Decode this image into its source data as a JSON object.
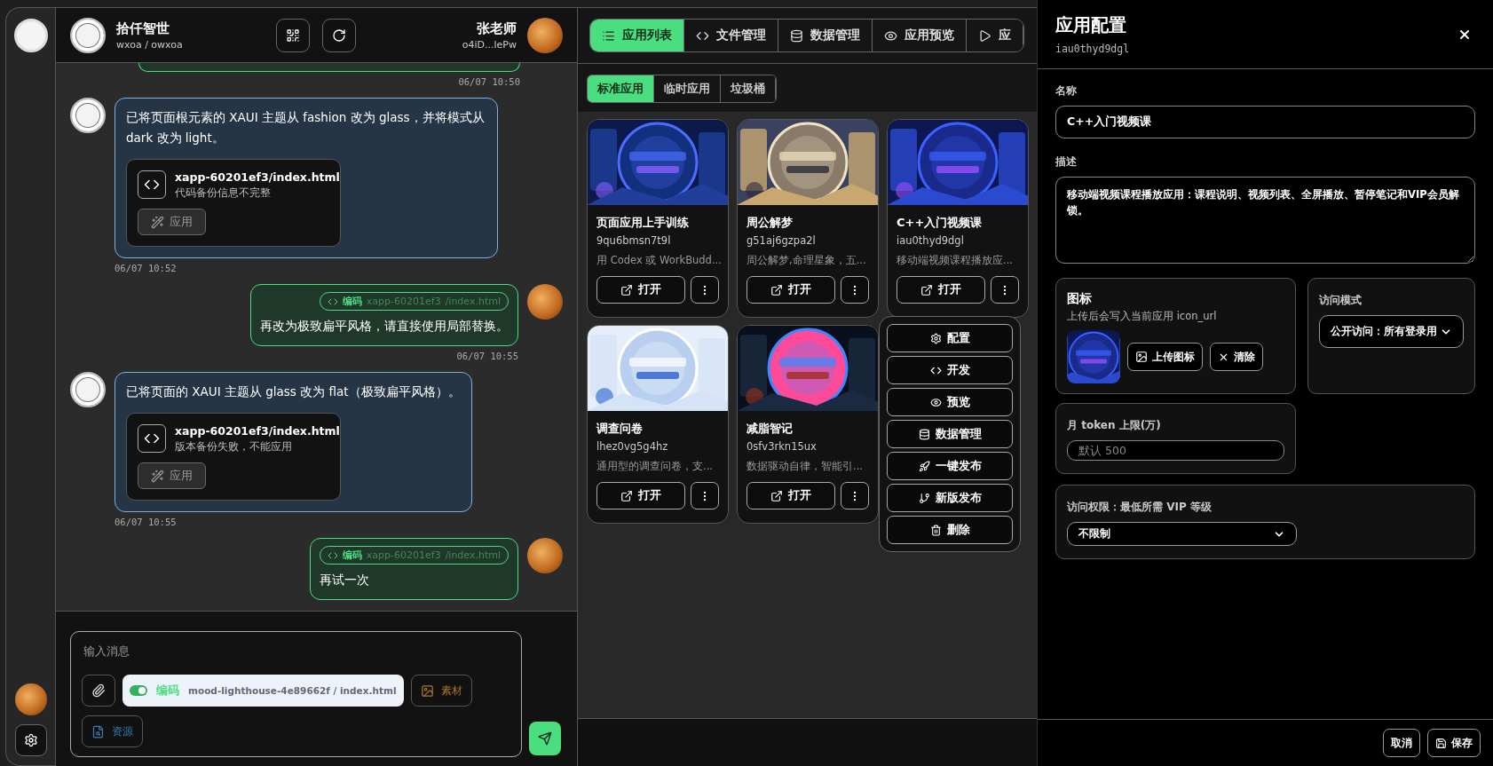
{
  "chat": {
    "header": {
      "title": "拾仟智世",
      "subtitle": "wxoa / owxoa",
      "user_name": "张老师",
      "user_id": "o4iD...lePw"
    },
    "messages": [
      {
        "kind": "user_stub",
        "time": "06/07 10:50"
      },
      {
        "kind": "bot",
        "text": "已将页面根元素的 XAUI 主题从 fashion 改为 glass，并将模式从 dark 改为 light。",
        "file": {
          "name": "xapp-60201ef3/index.html",
          "note": "代码备份信息不完整",
          "action": "应用",
          "disabled": true
        },
        "time": "06/07 10:52"
      },
      {
        "kind": "user",
        "tag": {
          "label": "编码",
          "app": "xapp-60201ef3",
          "path": "/index.html"
        },
        "text": "再改为极致扁平风格，请直接使用局部替换。",
        "time": "06/07 10:55"
      },
      {
        "kind": "bot",
        "text": "已将页面的 XAUI 主题从 glass 改为 flat（极致扁平风格）。",
        "file": {
          "name": "xapp-60201ef3/index.html",
          "note": "版本备份失败，不能应用",
          "action": "应用",
          "disabled": true
        },
        "time": "06/07 10:55"
      },
      {
        "kind": "user",
        "tag": {
          "label": "编码",
          "app": "xapp-60201ef3",
          "path": "/index.html"
        },
        "text": "再试一次"
      }
    ],
    "composer": {
      "placeholder": "输入消息",
      "mode_chip": {
        "on": true,
        "label": "编码",
        "path": "mood-lighthouse-4e89662f / index.html"
      },
      "material_button": "素材",
      "resource_button": "资源"
    }
  },
  "middle": {
    "tabs": [
      {
        "label": "应用列表",
        "selected": true
      },
      {
        "label": "文件管理",
        "selected": false
      },
      {
        "label": "数据管理",
        "selected": false
      },
      {
        "label": "应用预览",
        "selected": false
      },
      {
        "label": "应",
        "selected": false
      }
    ],
    "subtabs": [
      {
        "label": "标准应用",
        "selected": true
      },
      {
        "label": "临时应用",
        "selected": false
      },
      {
        "label": "垃圾桶",
        "selected": false
      }
    ],
    "apps": [
      {
        "name": "页面应用上手训练",
        "id": "9qu6bmsn7t9l",
        "description": "用 Codex 或 WorkBudd...",
        "open": "打开"
      },
      {
        "name": "周公解梦",
        "id": "g51aj6gzpa2l",
        "description": "周公解梦,命理星象，五...",
        "open": "打开"
      },
      {
        "name": "C++入门视频课",
        "id": "iau0thyd9dgl",
        "description": "移动端视频课程播放应...",
        "open": "打开"
      },
      {
        "name": "调查问卷",
        "id": "lhez0vg5g4hz",
        "description": "通用型的调查问卷，支...",
        "open": "打开"
      },
      {
        "name": "减脂智记",
        "id": "0sfv3rkn15ux",
        "description": "数据驱动自律，智能引...",
        "open": "打开"
      }
    ],
    "menu": [
      "配置",
      "开发",
      "预览",
      "数据管理",
      "一键发布",
      "新版发布",
      "删除"
    ]
  },
  "drawer": {
    "title": "应用配置",
    "subtitle": "iau0thyd9dgl",
    "name_label": "名称",
    "name_value": "C++入门视频课",
    "description_label": "描述",
    "description_value": "移动端视频课程播放应用：课程说明、视频列表、全屏播放、暂停笔记和VIP会员解锁。",
    "icon_title": "图标",
    "icon_hint": "上传后会写入当前应用 icon_url",
    "upload_button": "上传图标",
    "clear_button": "清除",
    "access_mode_label": "访问模式",
    "access_mode_value": "公开访问：所有登录用",
    "token_label": "月 token 上限(万)",
    "token_placeholder": "默认 500",
    "vip_label": "访问权限：最低所需 VIP 等级",
    "vip_value": "不限制",
    "cancel_button": "取消",
    "save_button": "保存"
  }
}
